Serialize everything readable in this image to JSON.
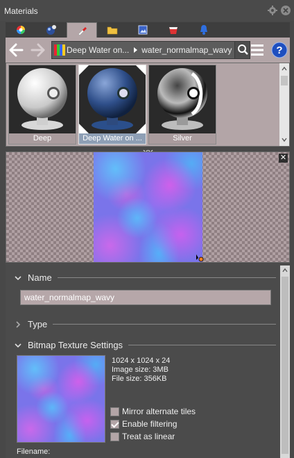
{
  "panel": {
    "title": "Materials"
  },
  "tabs": [
    {
      "icon": "color-wheel-icon"
    },
    {
      "icon": "spheres-icon"
    },
    {
      "icon": "paint-brush-icon",
      "active": true
    },
    {
      "icon": "folder-icon"
    },
    {
      "icon": "image-icon"
    },
    {
      "icon": "layers-icon"
    },
    {
      "icon": "bell-icon"
    }
  ],
  "breadcrumb": {
    "item1": "Deep Water on...",
    "item2": "water_normalmap_wavy"
  },
  "library": {
    "materials": [
      {
        "label": "Deep"
      },
      {
        "label": "Deep Water on ...",
        "selected": true
      },
      {
        "label": "Silver"
      }
    ]
  },
  "properties": {
    "name_header": "Name",
    "name_value": "water_normalmap_wavy",
    "type_header": "Type",
    "bitmap_header": "Bitmap Texture Settings",
    "info": {
      "dimensions": "1024 x 1024 x 24",
      "image_size": "Image size: 3MB",
      "file_size": "File size: 356KB"
    },
    "options": {
      "mirror": "Mirror alternate tiles",
      "filtering": "Enable filtering",
      "linear": "Treat as linear"
    },
    "filename_label": "Filename:"
  },
  "colors": {
    "accent_panel": "#b3a5a7",
    "selected_label": "#8e9fb5",
    "help_blue": "#1f4fbf"
  }
}
